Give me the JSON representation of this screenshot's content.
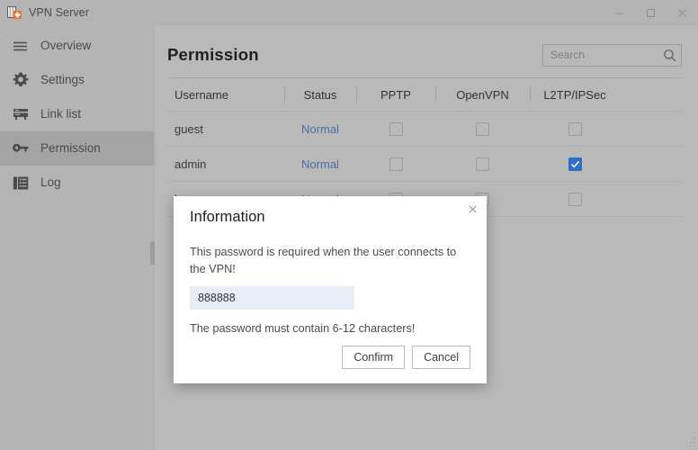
{
  "window": {
    "title": "VPN Server",
    "logo_icon": "server-rack-icon",
    "controls": {
      "minimize_label": "Minimize",
      "maximize_label": "Maximize",
      "close_label": "Close"
    }
  },
  "sidebar": {
    "items": [
      {
        "label": "Overview",
        "icon": "hamburger-menu-icon",
        "active": false
      },
      {
        "label": "Settings",
        "icon": "gear-icon",
        "active": false
      },
      {
        "label": "Link list",
        "icon": "server-icon",
        "active": false
      },
      {
        "label": "Permission",
        "icon": "key-icon",
        "active": true
      },
      {
        "label": "Log",
        "icon": "document-list-icon",
        "active": false
      }
    ],
    "collapse_handle_name": "sidebar-collapse-handle"
  },
  "main": {
    "title": "Permission",
    "search": {
      "placeholder": "Search",
      "value": "",
      "icon": "search-icon"
    },
    "table": {
      "columns": [
        "Username",
        "Status",
        "PPTP",
        "OpenVPN",
        "L2TP/IPSec"
      ],
      "rows": [
        {
          "username": "guest",
          "status": "Normal",
          "pptp": false,
          "openvpn": false,
          "l2tp": false
        },
        {
          "username": "admin",
          "status": "Normal",
          "pptp": false,
          "openvpn": false,
          "l2tp": true
        },
        {
          "username": "hansago",
          "status": "Normal",
          "pptp": false,
          "openvpn": false,
          "l2tp": false
        }
      ]
    }
  },
  "modal": {
    "title": "Information",
    "close_icon": "close-icon",
    "message": "This password is required when the user connects to the VPN!",
    "password": {
      "value": "888888",
      "placeholder": ""
    },
    "hint": "The password must contain 6-12 characters!",
    "confirm_label": "Confirm",
    "cancel_label": "Cancel"
  },
  "colors": {
    "window_chrome": "#b4b4b4",
    "content_bg": "#b9b9b9",
    "sidebar_active": "#a4a4a4",
    "status_text": "#4a6fa5",
    "checkbox_checked": "#2f6fc4",
    "modal_bg": "#ffffff",
    "input_bg": "#e8eef8",
    "logo_accent": "#e8732a"
  }
}
